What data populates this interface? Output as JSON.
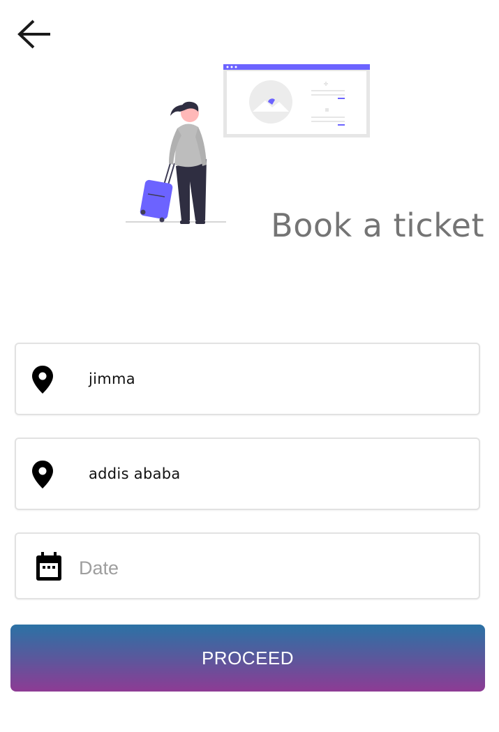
{
  "header": {
    "back_icon": "arrow-left-icon"
  },
  "illustration": {
    "name": "traveler-with-suitcase-illustration",
    "accent_color": "#6c63ff"
  },
  "title": "Book a ticket",
  "form": {
    "from": {
      "icon": "location-pin-icon",
      "value": "jimma"
    },
    "to": {
      "icon": "location-pin-icon",
      "value": "addis ababa"
    },
    "date": {
      "icon": "calendar-icon",
      "placeholder": "Date"
    }
  },
  "proceed_button": {
    "label": "PROCEED",
    "gradient_top": "#2b72a5",
    "gradient_bottom": "#8e3b94"
  }
}
